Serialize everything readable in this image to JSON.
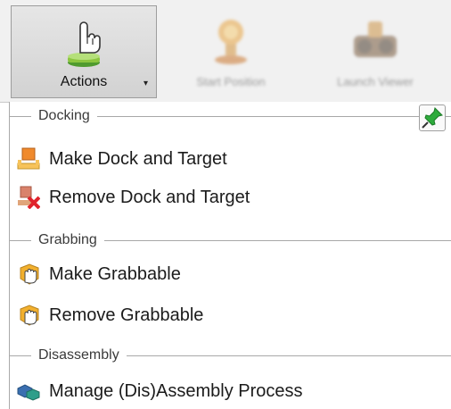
{
  "ribbon": {
    "actions_label": "Actions",
    "actions_icon": "pointing-hand-button-icon",
    "start_position_label": "Start Position",
    "start_position_icon": "start-position-icon",
    "launch_viewer_label": "Launch Viewer",
    "launch_viewer_icon": "launch-viewer-icon",
    "dropdown_glyph": "▾"
  },
  "menu": {
    "sections": {
      "docking": "Docking",
      "grabbing": "Grabbing",
      "disassembly": "Disassembly"
    },
    "items": {
      "make_dock": {
        "label": "Make Dock and Target",
        "icon": "dock-target-icon"
      },
      "remove_dock": {
        "label": "Remove Dock and Target",
        "icon": "remove-dock-icon"
      },
      "make_grabbable": {
        "label": "Make Grabbable",
        "icon": "grab-hand-icon"
      },
      "remove_grabbable": {
        "label": "Remove Grabbable",
        "icon": "grab-hand-icon"
      },
      "manage_assembly": {
        "label": "Manage (Dis)Assembly Process",
        "icon": "assembly-parts-icon"
      }
    },
    "pin_icon": "pin-icon"
  },
  "colors": {
    "ribbon_bg": "#f1f1f1",
    "pressed_button_bg": "#d8d8d8",
    "separator": "#a8a8a8",
    "dock_orange": "#f08a2c",
    "remove_red": "#e0242c",
    "grab_yellow": "#f2b02e",
    "assembly_blue": "#3a6fb0",
    "pin_green": "#2eab3c"
  }
}
